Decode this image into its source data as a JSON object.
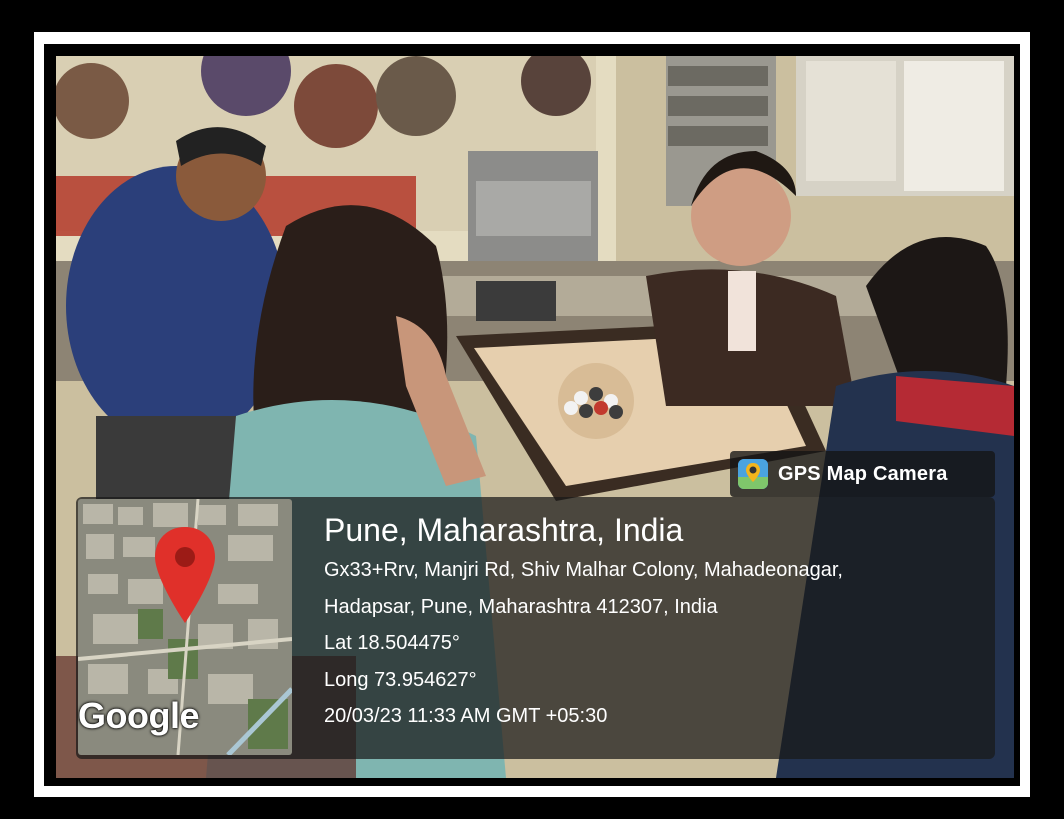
{
  "overlay": {
    "app_name": "GPS Map Camera",
    "app_icon": "gps-map-camera-icon",
    "location_title": "Pune, Maharashtra, India",
    "address_line_1": "Gx33+Rrv, Manjri Rd, Shiv Malhar Colony, Mahadeonagar,",
    "address_line_2": "Hadapsar, Pune, Maharashtra 412307, India",
    "latitude": "Lat 18.504475°",
    "longitude": "Long 73.954627°",
    "timestamp": "20/03/23 11:33 AM GMT +05:30",
    "map_brand": "Google",
    "map_pin_icon": "map-pin-icon"
  },
  "colors": {
    "frame": "#000000",
    "mat": "#ffffff",
    "overlay_bg": "#1a1a1a",
    "pin": "#e0302a",
    "text": "#ffffff"
  }
}
